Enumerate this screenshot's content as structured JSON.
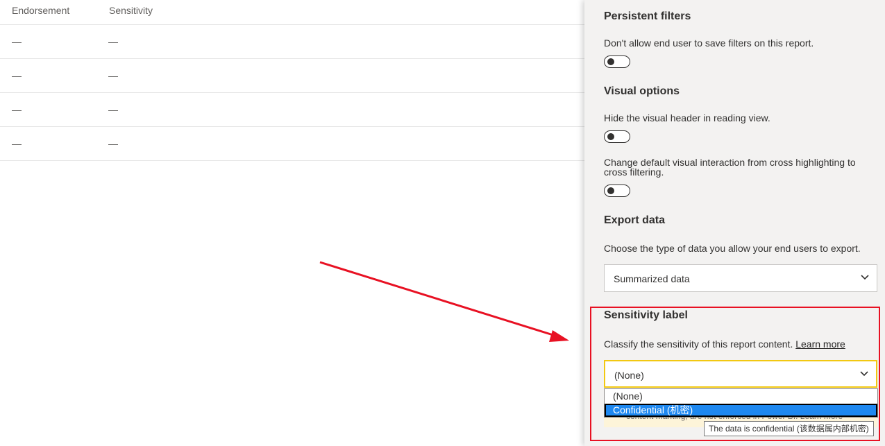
{
  "table": {
    "columns": [
      "Endorsement",
      "Sensitivity"
    ],
    "rows": [
      [
        "—",
        "—"
      ],
      [
        "—",
        "—"
      ],
      [
        "—",
        "—"
      ],
      [
        "—",
        "—"
      ]
    ]
  },
  "panel": {
    "persistent_filters": {
      "title": "Persistent filters",
      "desc": "Don't allow end user to save filters on this report.",
      "toggle_on": false
    },
    "visual_options": {
      "title": "Visual options",
      "desc1": "Hide the visual header in reading view.",
      "toggle1_on": false,
      "desc2": "Change default visual interaction from cross highlighting to cross filtering.",
      "toggle2_on": false
    },
    "export_data": {
      "title": "Export data",
      "desc": "Choose the type of data you allow your end users to export.",
      "selected": "Summarized data"
    },
    "sensitivity_label": {
      "title": "Sensitivity label",
      "desc": "Classify the sensitivity of this report content.",
      "learn_more": "Learn more",
      "selected": "(None)",
      "options": [
        "(None)",
        "Confidential (机密)"
      ],
      "highlighted_option": "Confidential (机密)",
      "notice_fragment": "content marking, are not enforced in Power BI. Learn more",
      "tooltip": "The data is confidential (该数据属内部机密)"
    }
  },
  "colors": {
    "panel_bg": "#f3f2f1",
    "focus_border": "#f2c811",
    "selection": "#1e88f0",
    "annotation": "#e81123"
  },
  "icons": [
    "chevron-down-icon",
    "annotation-arrow"
  ]
}
